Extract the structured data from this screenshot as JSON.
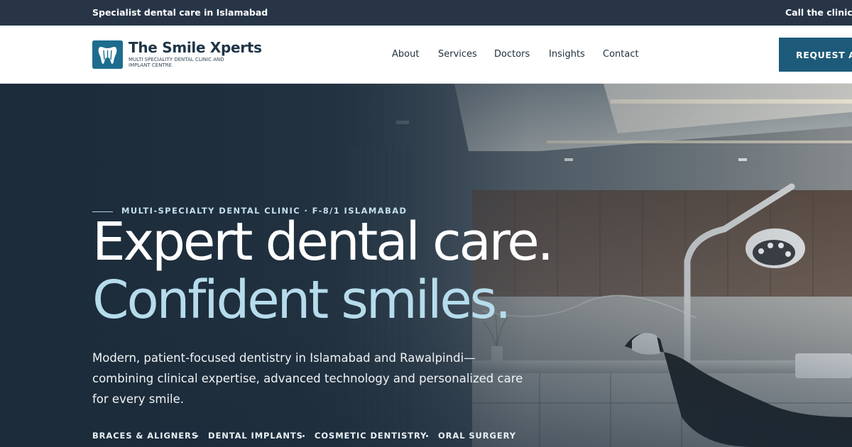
{
  "topbar": {
    "tagline": "Specialist dental care in Islamabad",
    "call": "Call the clinic ·"
  },
  "brand": {
    "name": "The Smile Xperts",
    "subtitle": "MULTI SPECIALITY DENTAL CLINIC AND IMPLANT CENTRE",
    "logo_icon": "tooth-icon",
    "color": "#1d6d8f"
  },
  "nav": {
    "items": [
      "About",
      "Services",
      "Doctors",
      "Insights",
      "Contact"
    ],
    "cta_label": "REQUEST AP"
  },
  "hero": {
    "eyebrow": "MULTI-SPECIALTY DENTAL CLINIC · F-8/1 ISLAMABAD",
    "heading_line1": "Expert dental care.",
    "heading_line2": "Confident smiles.",
    "lead": "Modern, patient-focused dentistry in Islamabad and Rawalpindi—combining clinical expertise, advanced technology and personalized care for every smile.",
    "tags": [
      "BRACES & ALIGNERS",
      "DENTAL IMPLANTS",
      "COSMETIC DENTISTRY",
      "ORAL SURGERY"
    ]
  },
  "colors": {
    "topbar_bg": "#273547",
    "cta_bg": "#1d5a7a",
    "accent_light": "#b6dcec"
  }
}
